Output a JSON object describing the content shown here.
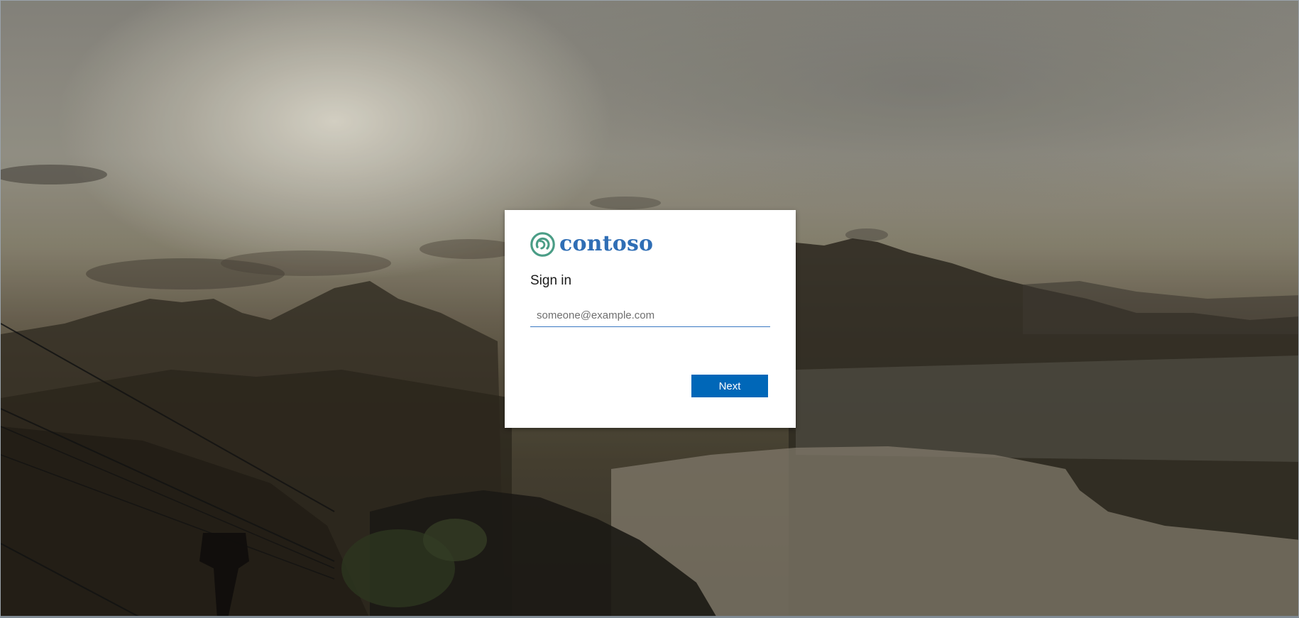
{
  "brand": {
    "name": "contoso",
    "logo_icon": "contoso-ring-logo-icon",
    "name_color": "#2f6eb5",
    "logo_color": "#4a9d86"
  },
  "signin": {
    "title": "Sign in",
    "email_placeholder": "someone@example.com",
    "email_value": "",
    "next_label": "Next"
  },
  "colors": {
    "primary_button": "#0067b8",
    "input_underline": "#3a78c2",
    "card_background": "#ffffff"
  }
}
